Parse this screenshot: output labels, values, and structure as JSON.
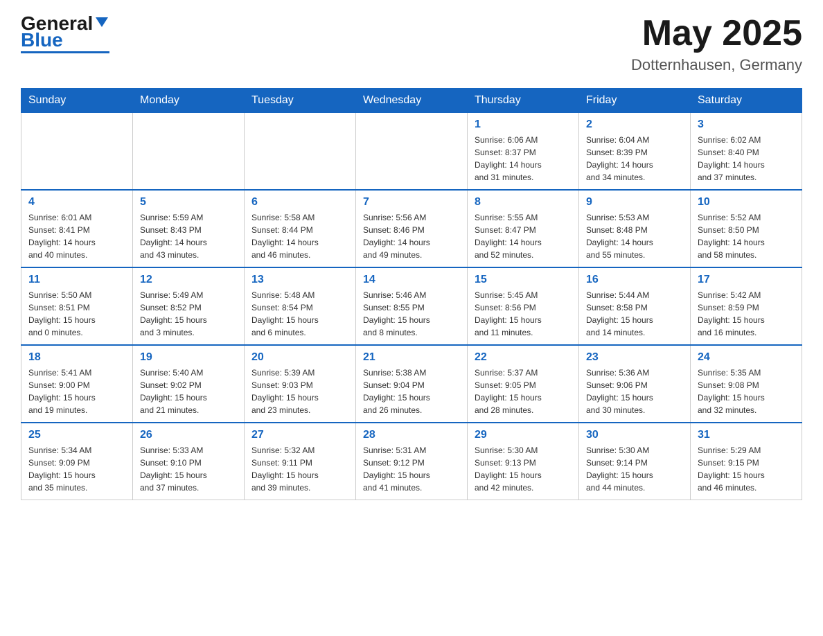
{
  "header": {
    "logo_general": "General",
    "logo_blue": "Blue",
    "month_year": "May 2025",
    "location": "Dotternhausen, Germany"
  },
  "weekdays": [
    "Sunday",
    "Monday",
    "Tuesday",
    "Wednesday",
    "Thursday",
    "Friday",
    "Saturday"
  ],
  "weeks": [
    [
      {
        "day": "",
        "info": ""
      },
      {
        "day": "",
        "info": ""
      },
      {
        "day": "",
        "info": ""
      },
      {
        "day": "",
        "info": ""
      },
      {
        "day": "1",
        "info": "Sunrise: 6:06 AM\nSunset: 8:37 PM\nDaylight: 14 hours\nand 31 minutes."
      },
      {
        "day": "2",
        "info": "Sunrise: 6:04 AM\nSunset: 8:39 PM\nDaylight: 14 hours\nand 34 minutes."
      },
      {
        "day": "3",
        "info": "Sunrise: 6:02 AM\nSunset: 8:40 PM\nDaylight: 14 hours\nand 37 minutes."
      }
    ],
    [
      {
        "day": "4",
        "info": "Sunrise: 6:01 AM\nSunset: 8:41 PM\nDaylight: 14 hours\nand 40 minutes."
      },
      {
        "day": "5",
        "info": "Sunrise: 5:59 AM\nSunset: 8:43 PM\nDaylight: 14 hours\nand 43 minutes."
      },
      {
        "day": "6",
        "info": "Sunrise: 5:58 AM\nSunset: 8:44 PM\nDaylight: 14 hours\nand 46 minutes."
      },
      {
        "day": "7",
        "info": "Sunrise: 5:56 AM\nSunset: 8:46 PM\nDaylight: 14 hours\nand 49 minutes."
      },
      {
        "day": "8",
        "info": "Sunrise: 5:55 AM\nSunset: 8:47 PM\nDaylight: 14 hours\nand 52 minutes."
      },
      {
        "day": "9",
        "info": "Sunrise: 5:53 AM\nSunset: 8:48 PM\nDaylight: 14 hours\nand 55 minutes."
      },
      {
        "day": "10",
        "info": "Sunrise: 5:52 AM\nSunset: 8:50 PM\nDaylight: 14 hours\nand 58 minutes."
      }
    ],
    [
      {
        "day": "11",
        "info": "Sunrise: 5:50 AM\nSunset: 8:51 PM\nDaylight: 15 hours\nand 0 minutes."
      },
      {
        "day": "12",
        "info": "Sunrise: 5:49 AM\nSunset: 8:52 PM\nDaylight: 15 hours\nand 3 minutes."
      },
      {
        "day": "13",
        "info": "Sunrise: 5:48 AM\nSunset: 8:54 PM\nDaylight: 15 hours\nand 6 minutes."
      },
      {
        "day": "14",
        "info": "Sunrise: 5:46 AM\nSunset: 8:55 PM\nDaylight: 15 hours\nand 8 minutes."
      },
      {
        "day": "15",
        "info": "Sunrise: 5:45 AM\nSunset: 8:56 PM\nDaylight: 15 hours\nand 11 minutes."
      },
      {
        "day": "16",
        "info": "Sunrise: 5:44 AM\nSunset: 8:58 PM\nDaylight: 15 hours\nand 14 minutes."
      },
      {
        "day": "17",
        "info": "Sunrise: 5:42 AM\nSunset: 8:59 PM\nDaylight: 15 hours\nand 16 minutes."
      }
    ],
    [
      {
        "day": "18",
        "info": "Sunrise: 5:41 AM\nSunset: 9:00 PM\nDaylight: 15 hours\nand 19 minutes."
      },
      {
        "day": "19",
        "info": "Sunrise: 5:40 AM\nSunset: 9:02 PM\nDaylight: 15 hours\nand 21 minutes."
      },
      {
        "day": "20",
        "info": "Sunrise: 5:39 AM\nSunset: 9:03 PM\nDaylight: 15 hours\nand 23 minutes."
      },
      {
        "day": "21",
        "info": "Sunrise: 5:38 AM\nSunset: 9:04 PM\nDaylight: 15 hours\nand 26 minutes."
      },
      {
        "day": "22",
        "info": "Sunrise: 5:37 AM\nSunset: 9:05 PM\nDaylight: 15 hours\nand 28 minutes."
      },
      {
        "day": "23",
        "info": "Sunrise: 5:36 AM\nSunset: 9:06 PM\nDaylight: 15 hours\nand 30 minutes."
      },
      {
        "day": "24",
        "info": "Sunrise: 5:35 AM\nSunset: 9:08 PM\nDaylight: 15 hours\nand 32 minutes."
      }
    ],
    [
      {
        "day": "25",
        "info": "Sunrise: 5:34 AM\nSunset: 9:09 PM\nDaylight: 15 hours\nand 35 minutes."
      },
      {
        "day": "26",
        "info": "Sunrise: 5:33 AM\nSunset: 9:10 PM\nDaylight: 15 hours\nand 37 minutes."
      },
      {
        "day": "27",
        "info": "Sunrise: 5:32 AM\nSunset: 9:11 PM\nDaylight: 15 hours\nand 39 minutes."
      },
      {
        "day": "28",
        "info": "Sunrise: 5:31 AM\nSunset: 9:12 PM\nDaylight: 15 hours\nand 41 minutes."
      },
      {
        "day": "29",
        "info": "Sunrise: 5:30 AM\nSunset: 9:13 PM\nDaylight: 15 hours\nand 42 minutes."
      },
      {
        "day": "30",
        "info": "Sunrise: 5:30 AM\nSunset: 9:14 PM\nDaylight: 15 hours\nand 44 minutes."
      },
      {
        "day": "31",
        "info": "Sunrise: 5:29 AM\nSunset: 9:15 PM\nDaylight: 15 hours\nand 46 minutes."
      }
    ]
  ]
}
